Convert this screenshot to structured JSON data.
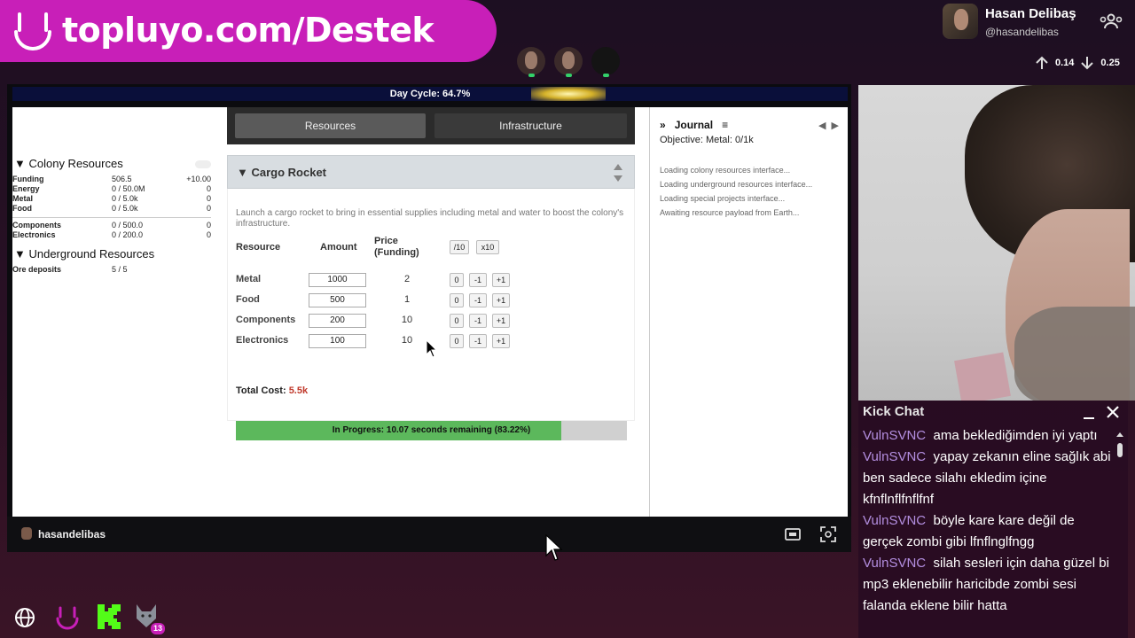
{
  "banner": {
    "text": "topluyo.com/Destek"
  },
  "profile": {
    "name": "Hasan Delibaş",
    "handle": "@hasandelibas"
  },
  "stats": {
    "up": "0.14",
    "down": "0.25"
  },
  "game": {
    "day_cycle": "Day Cycle: 64.7%",
    "colony_resources": {
      "title": "▼ Colony Resources",
      "rows": [
        {
          "name": "Funding",
          "value": "506.5",
          "rate": "+10.00"
        },
        {
          "name": "Energy",
          "value": "0 / 50.0M",
          "rate": "0"
        },
        {
          "name": "Metal",
          "value": "0 / 5.0k",
          "rate": "0"
        },
        {
          "name": "Food",
          "value": "0 / 5.0k",
          "rate": "0"
        },
        {
          "name": "Components",
          "value": "0 / 500.0",
          "rate": "0"
        },
        {
          "name": "Electronics",
          "value": "0 / 200.0",
          "rate": "0"
        }
      ]
    },
    "underground_resources": {
      "title": "▼ Underground Resources",
      "rows": [
        {
          "name": "Ore deposits",
          "value": "5 / 5"
        }
      ]
    },
    "tabs": [
      "Resources",
      "Infrastructure"
    ],
    "cargo": {
      "title": "▼ Cargo Rocket",
      "description": "Launch a cargo rocket to bring in essential supplies including metal and water to boost the colony's infrastructure.",
      "headers": {
        "resource": "Resource",
        "amount": "Amount",
        "price": "Price (Funding)"
      },
      "div_label": "/10",
      "mul_label": "x10",
      "btn_zero": "0",
      "btn_minus": "-1",
      "btn_plus": "+1",
      "rows": [
        {
          "name": "Metal",
          "amount": "1000",
          "price": "2"
        },
        {
          "name": "Food",
          "amount": "500",
          "price": "1"
        },
        {
          "name": "Components",
          "amount": "200",
          "price": "10"
        },
        {
          "name": "Electronics",
          "amount": "100",
          "price": "10"
        }
      ],
      "total_label": "Total Cost:",
      "total_value": "5.5k",
      "progress_text": "In Progress: 10.07 seconds remaining (83.22%)",
      "progress_fraction": 0.8322
    },
    "journal": {
      "title": "Journal",
      "objective": "Objective: Metal: 0/1k",
      "logs": [
        "Loading colony resources interface...",
        "Loading underground resources interface...",
        "Loading special projects interface...",
        "Awaiting resource payload from Earth..."
      ]
    }
  },
  "window_bar": {
    "username": "hasandelibas"
  },
  "chat": {
    "title": "Kick Chat",
    "messages": [
      {
        "user": "VulnSVNC",
        "text": "ama beklediğimden iyi yaptı"
      },
      {
        "user": "VulnSVNC",
        "text": "yapay zekanın eline sağlık abi ben sadece silahı ekledim içine kfnflnflfnflfnf"
      },
      {
        "user": "VulnSVNC",
        "text": "böyle kare kare değil de gerçek zombi gibi lfnflnglfngg"
      },
      {
        "user": "VulnSVNC",
        "text": "silah sesleri için daha güzel bi mp3 eklenebilir haricibde zombi sesi falanda eklene bilir hatta"
      }
    ]
  },
  "bottom": {
    "badge_count": "13"
  },
  "colors": {
    "brand_magenta": "#c81fb8",
    "progress_green": "#5cb85c",
    "total_red": "#c0392b",
    "chat_user": "#b38ee0"
  }
}
